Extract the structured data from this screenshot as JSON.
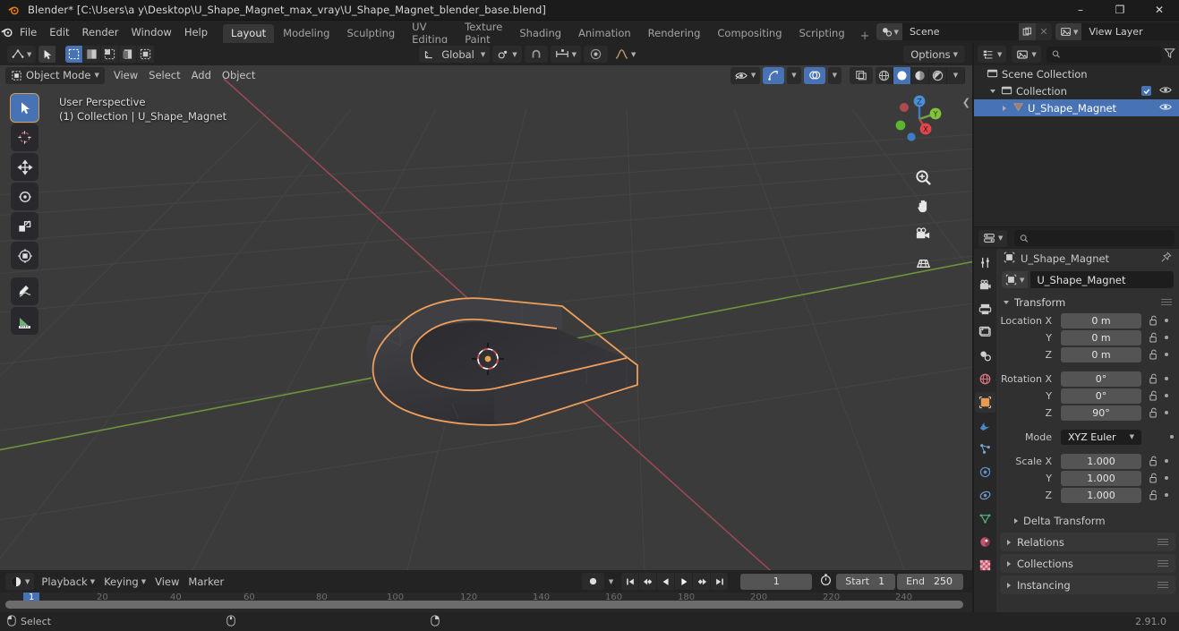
{
  "window": {
    "title": "Blender* [C:\\Users\\a y\\Desktop\\U_Shape_Magnet_max_vray\\U_Shape_Magnet_blender_base.blend]",
    "minimize": "–",
    "maximize": "❐",
    "close": "✕"
  },
  "topbar": {
    "menus": [
      "File",
      "Edit",
      "Render",
      "Window",
      "Help"
    ],
    "workspaces": [
      {
        "label": "Layout",
        "active": true
      },
      {
        "label": "Modeling",
        "active": false
      },
      {
        "label": "Sculpting",
        "active": false
      },
      {
        "label": "UV Editing",
        "active": false
      },
      {
        "label": "Texture Paint",
        "active": false
      },
      {
        "label": "Shading",
        "active": false
      },
      {
        "label": "Animation",
        "active": false
      },
      {
        "label": "Rendering",
        "active": false
      },
      {
        "label": "Compositing",
        "active": false
      },
      {
        "label": "Scripting",
        "active": false
      }
    ],
    "add_workspace": "+",
    "scene_name": "Scene",
    "view_layer_name": "View Layer"
  },
  "viewport": {
    "mode": "Object Mode",
    "menus": [
      "View",
      "Select",
      "Add",
      "Object"
    ],
    "transform_orientation": "Global",
    "options_label": "Options",
    "overlay_line1": "User Perspective",
    "overlay_line2": "(1) Collection | U_Shape_Magnet",
    "gizmo_axes": {
      "x": "X",
      "y": "Y",
      "z": "Z"
    },
    "colors": {
      "background": "#3b3b3b",
      "grid": "#4a4a4a",
      "x_axis": "#9b4a52",
      "y_axis": "#6c8f3f",
      "object_dark": "#36363a",
      "selection_outline": "#ed9e5c",
      "accent_blue": "#4772b3"
    },
    "tools": [
      {
        "name": "tweak-select-box",
        "active": true
      },
      {
        "name": "cursor",
        "active": false
      },
      {
        "name": "move",
        "active": false
      },
      {
        "name": "rotate",
        "active": false
      },
      {
        "name": "scale",
        "active": false
      },
      {
        "name": "transform",
        "active": false
      },
      {
        "name": "annotate",
        "active": false
      },
      {
        "name": "measure",
        "active": false
      }
    ]
  },
  "timeline": {
    "playback": "Playback",
    "keying": "Keying",
    "view": "View",
    "marker": "Marker",
    "current_frame": "1",
    "start_label": "Start",
    "start_value": "1",
    "end_label": "End",
    "end_value": "250",
    "ticks": [
      "20",
      "40",
      "60",
      "80",
      "100",
      "120",
      "140",
      "160",
      "180",
      "200",
      "220",
      "240"
    ]
  },
  "outliner": {
    "search_placeholder": "",
    "rows": [
      {
        "label": "Scene Collection",
        "depth": 0,
        "icon": "collection-icon",
        "selected": false,
        "has_toggle": false,
        "has_check": false,
        "has_eye": false
      },
      {
        "label": "Collection",
        "depth": 1,
        "icon": "collection-icon",
        "selected": false,
        "has_toggle": true,
        "has_check": true,
        "has_eye": true
      },
      {
        "label": "U_Shape_Magnet",
        "depth": 2,
        "icon": "mesh-object-icon",
        "selected": true,
        "has_toggle": true,
        "has_check": false,
        "has_eye": true
      }
    ]
  },
  "properties": {
    "search_placeholder": "",
    "breadcrumb_object": "U_Shape_Magnet",
    "object_name": "U_Shape_Magnet",
    "transform": {
      "title": "Transform",
      "rows": [
        {
          "label": "Location X",
          "value": "0 m"
        },
        {
          "label": "Y",
          "value": "0 m"
        },
        {
          "label": "Z",
          "value": "0 m"
        }
      ],
      "rotation": [
        {
          "label": "Rotation X",
          "value": "0°"
        },
        {
          "label": "Y",
          "value": "0°"
        },
        {
          "label": "Z",
          "value": "90°"
        }
      ],
      "mode_label": "Mode",
      "mode_value": "XYZ Euler",
      "scale": [
        {
          "label": "Scale X",
          "value": "1.000"
        },
        {
          "label": "Y",
          "value": "1.000"
        },
        {
          "label": "Z",
          "value": "1.000"
        }
      ]
    },
    "delta_transform": "Delta Transform",
    "closed_panels": [
      "Relations",
      "Collections",
      "Instancing"
    ],
    "tabs": [
      {
        "name": "tool-tab",
        "active": false
      },
      {
        "name": "render-tab",
        "active": false
      },
      {
        "name": "output-tab",
        "active": false
      },
      {
        "name": "view-layer-tab",
        "active": false
      },
      {
        "name": "scene-tab",
        "active": false
      },
      {
        "name": "world-tab",
        "active": false
      },
      {
        "name": "object-tab",
        "active": true
      },
      {
        "name": "modifier-tab",
        "active": false
      },
      {
        "name": "particles-tab",
        "active": false
      },
      {
        "name": "physics-tab",
        "active": false
      },
      {
        "name": "constraints-tab",
        "active": false
      },
      {
        "name": "object-data-tab",
        "active": false
      },
      {
        "name": "material-tab",
        "active": false
      },
      {
        "name": "texture-tab",
        "active": false
      }
    ]
  },
  "statusbar": {
    "select_label": "Select",
    "version": "2.91.0"
  }
}
